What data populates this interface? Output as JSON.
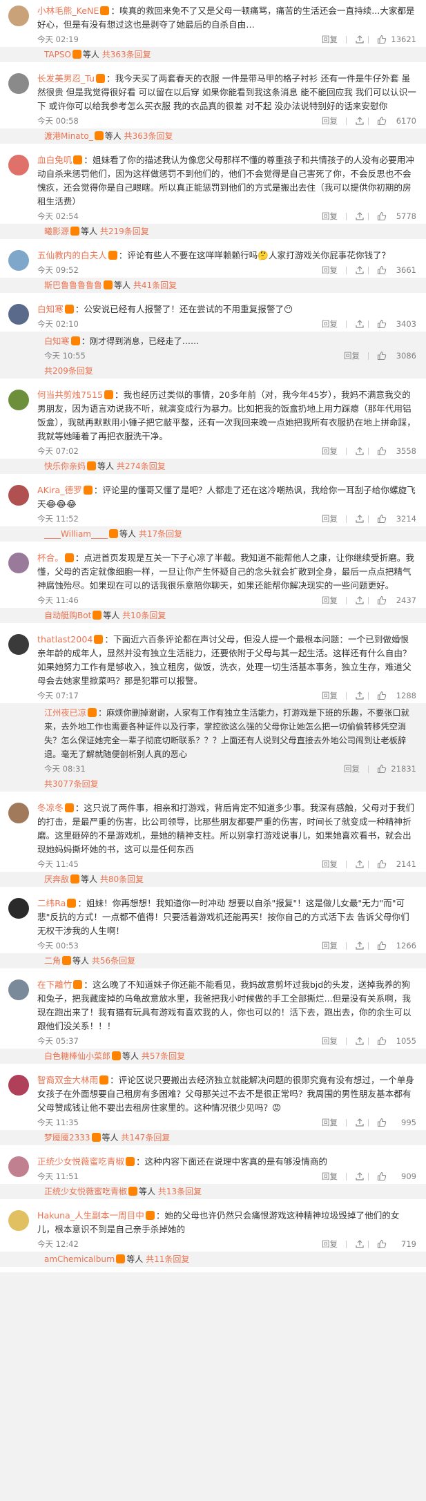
{
  "labels": {
    "reply": "回复",
    "others_suffix": "等人",
    "total_prefix": "共",
    "replies_suffix": "条回复"
  },
  "comments": [
    {
      "user": "小林毛熊_KeNE",
      "sep": "：",
      "text": "唉真的救回来免不了又是父母一顿痛骂，痛苦的生活还会一直持续...大家都是好心，但是有没有想过这也是剥夺了她最后的自杀自由…",
      "time": "今天 02:19",
      "likes": "13621",
      "avatar_color": "#c9a27a",
      "summary": {
        "user": "TAPSO",
        "count": "363"
      }
    },
    {
      "user": "长发美男忍_Tu",
      "sep": "：",
      "text": "我今天买了两套春天的衣服 一件是带马甲的格子衬衫 还有一件是牛仔外套 虽然很贵 但是我觉得很好看 可以留在以后穿 如果你能看到我这条消息 能不能回应我 我们可以认识一下 或许你可以给我参考怎么买衣服 我的衣品真的很差 对不起 没办法说特别好的话来安慰你",
      "time": "今天 00:58",
      "likes": "6170",
      "avatar_color": "#8a8a8a",
      "summary": {
        "user": "渡港Minato_",
        "count": "363"
      }
    },
    {
      "user": "血白兔叽",
      "sep": "：",
      "text": "姐妹看了你的描述我认为像您父母那样不懂的尊重孩子和共情孩子的人没有必要用冲动自杀来惩罚他们，因为这样做惩罚不到他们的，他们不会觉得是自己害死了你，不会反思也不会愧疚，还会觉得你是自己眼瞎。所以真正能惩罚到他们的方式是搬出去住（我可以提供你初期的房租生活费）",
      "time": "今天 02:54",
      "likes": "5778",
      "avatar_color": "#e0706a",
      "summary": {
        "user": "曦影源",
        "count": "219"
      }
    },
    {
      "user": "五仙教内的白夫人",
      "sep": "：",
      "text": "评论有些人不要在这咩咩赖赖行吗🤔人家打游戏关你屁事花你钱了？",
      "time": "今天 09:52",
      "likes": "3661",
      "avatar_color": "#7fa7c9",
      "summary": {
        "user": "斯巴鲁鲁鲁鲁鲁",
        "count": "41"
      }
    },
    {
      "user": "白知寒",
      "sep": "：",
      "text": "公安说已经有人报警了！还在尝试的不用重复报警了😶",
      "time": "今天 02:10",
      "likes": "3403",
      "avatar_color": "#5a6a8a",
      "sub": {
        "user": "白知寒",
        "text": "刚才得到消息，已经走了……",
        "time": "今天 10:55",
        "likes": "3086"
      },
      "summary": {
        "user": "",
        "count": "209"
      }
    },
    {
      "user": "何当共剪烛7515",
      "sep": "：",
      "text": "我也经历过类似的事情，20多年前（对，我今年45岁），我妈不满意我交的男朋友，因为语言劝说我不听，就演变成行为暴力。比如把我的饭盒扔地上用力踩瘪（那年代用铝饭盒），我就再默默用小锤子把它敲平整，还有一次我回来晚一点她把我所有衣服扔在地上拼命踩，我就等她睡着了再把衣服洗干净。",
      "time": "今天 07:02",
      "likes": "3558",
      "avatar_color": "#6b8f3a",
      "summary": {
        "user": "快乐你亲妈",
        "count": "274"
      }
    },
    {
      "user": "AKira_德罗",
      "sep": "：",
      "text": "评论里的懂哥又懂了是吧？人都走了还在这冷嘲热讽，我给你一耳刮子给你螺旋飞天😂😂😂",
      "time": "今天 11:52",
      "likes": "3214",
      "avatar_color": "#b05050",
      "summary": {
        "user": "____William____",
        "count": "17"
      }
    },
    {
      "user": "杯合。",
      "sep": "：",
      "text": "点进首页发现是互关一下子心凉了半截。我知道不能帮他人之康，让你继续受折磨。我懂，父母的否定就像细胞一样，一旦让你产生怀疑自己的念头就会扩散到全身，最后一点点把精气神腐蚀殆尽。如果现在可以的话我很乐意陪你聊天，如果还能帮你解决现实的一些问题更好。",
      "time": "今天 11:46",
      "likes": "2437",
      "avatar_color": "#9a7a9a",
      "summary": {
        "user": "自动艇购Bot",
        "count": "10"
      }
    },
    {
      "user": "thatlast2004",
      "sep": "：",
      "text": "下面近六百条评论都在声讨父母，但没人提一个最根本问题：一个已到做婚恨亲年龄的成年人，显然并没有独立生活能力，还要依附于父母与其一起生活。这样还有什么自由？如果她努力工作有是够收入，独立租房，做饭，洗衣，处理一切生活基本事务，独立生存，难道父母会去她家里掀菜吗？那是犯罪可以报警。",
      "time": "今天 07:17",
      "likes": "1288",
      "avatar_color": "#3a3a3a",
      "sub": {
        "user": "江州夜已凉",
        "text": "麻烦你删掉谢谢，人家有工作有独立生活能力，打游戏是下班的乐趣，不要张口就来，去外地工作也需要各种证件以及行李，掌控欲这么强的父母你让她怎么把一切偷偷转移凭空消失？怎么保证她完全一辈子彻底切断联系？？？上面还有人说到父母直接去外地公司闹到让老板辞退。毫无了解就随便剖析别人真的恶心",
        "time": "今天 08:31",
        "likes": "21831"
      },
      "summary": {
        "user": "",
        "count": "3077"
      }
    },
    {
      "user": "冬凉冬",
      "sep": "：",
      "text": "这只说了两件事，相亲和打游戏，背后肯定不知道多少事。我深有感触，父母对于我们的打击，是最严重的伤害，比公司领导，比那些朋友都要严重的伤害，时间长了就变成一种精神折磨。这里砸碎的不是游戏机，是她的精神支柱。所以别拿打游戏说事儿，如果她喜欢看书，就会出现她妈妈撕坏她的书，这可以是任何东西",
      "time": "今天 11:45",
      "likes": "2141",
      "avatar_color": "#a07a5a",
      "summary": {
        "user": "厌奔敌",
        "count": "80"
      }
    },
    {
      "user": "二纬Ra",
      "sep": "：",
      "text": "姐妹！你再想想！我知道你一时冲动 想要以自杀\"报复\"！这是做儿女最\"无力\"而\"可悲\"反抗的方式！一点都不值得！只要活着游戏机还能再买！按你自己的方式活下去 告诉父母你们无权干涉我的人生啊！",
      "time": "今天 00:53",
      "likes": "1266",
      "avatar_color": "#2a2a2a",
      "summary": {
        "user": "二角",
        "count": "56"
      }
    },
    {
      "user": "在下離竹",
      "sep": "：",
      "text": "这么晚了不知道妹子你还能不能看见，我妈故意剪坏过我bjd的头发，送掉我养的狗和兔子，把我藏废掉的乌龟故意放水里，我爸把我小时候做的手工全部撕烂...但是没有关系啊，我现在跑出来了！我有猫有玩具有游戏有喜欢我的人，你也可以的！活下去，跑出去，你的余生可以跟他们没关系！！！",
      "time": "今天 05:37",
      "likes": "1055",
      "avatar_color": "#7a8a9a",
      "summary": {
        "user": "白色糖棒仙小菜郎",
        "count": "57"
      }
    },
    {
      "user": "智裔双金大林雨",
      "sep": "：",
      "text": "评论区说只要搬出去经济独立就能解决问题的很郧究竟有没有想过，一个单身女孩子在外面想要自己租房有多困难？父母那关过不去不是很正常吗？我周围的男性朋友基本都有父母赞成钱让他不要出去租房住家里的。这种情况很少见吗？😡",
      "time": "今天 11:35",
      "likes": "995",
      "avatar_color": "#b0405a",
      "summary": {
        "user": "梦魇魇2333",
        "count": "147"
      }
    },
    {
      "user": "正统少女悦薇蜜吃青椒",
      "sep": "：",
      "text": "这种内容下面还在说理中客真的是有够没情商的",
      "time": "今天 11:51",
      "likes": "909",
      "avatar_color": "#c08090",
      "summary": {
        "user": "正统少女悦薇蜜吃青椒",
        "count": "13"
      }
    },
    {
      "user": "Hakuna_人生副本一周目中",
      "sep": "：",
      "text": "她的父母也许仍然只会痛恨游戏这种精神垃圾毁掉了他们的女儿，根本意识不到是自己亲手杀掉她的",
      "time": "今天 12:42",
      "likes": "719",
      "avatar_color": "#e0c060",
      "summary": {
        "user": "amChemicalburn",
        "count": "11"
      }
    }
  ]
}
